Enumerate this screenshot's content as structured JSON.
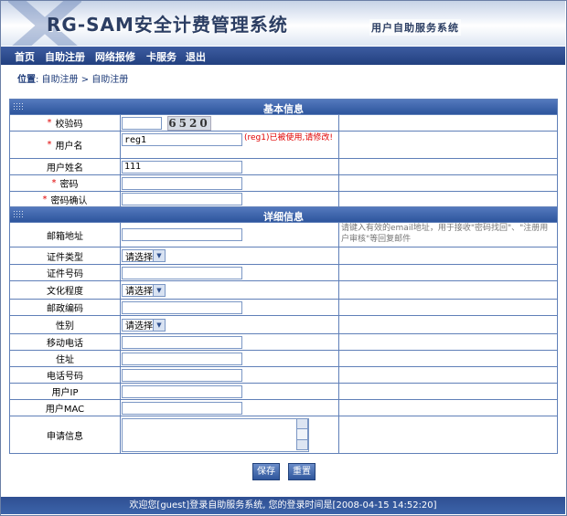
{
  "header": {
    "logo": "RG-SAM安全计费管理系统",
    "subtitle": "用户自助服务系统"
  },
  "nav": [
    "首页",
    "自助注册",
    "网络报修",
    "卡服务",
    "退出"
  ],
  "breadcrumb": {
    "label": "位置",
    "path": ": 自助注册 > 自助注册"
  },
  "basic": {
    "title": "基本信息",
    "captcha_label": "校验码",
    "captcha_code": "6520",
    "username_label": "用户名",
    "username_value": "reg1",
    "username_error": "(reg1)已被使用,请修改!",
    "realname_label": "用户姓名",
    "realname_value": "111",
    "password_label": "密码",
    "password_confirm_label": "密码确认"
  },
  "detail": {
    "title": "详细信息",
    "email_label": "邮箱地址",
    "email_hint": "请键入有效的email地址，用于接收\"密码找回\"、\"注册用户审核\"等回复邮件",
    "idtype_label": "证件类型",
    "idnum_label": "证件号码",
    "edu_label": "文化程度",
    "zip_label": "邮政编码",
    "gender_label": "性别",
    "mobile_label": "移动电话",
    "address_label": "住址",
    "phone_label": "电话号码",
    "ip_label": "用户IP",
    "mac_label": "用户MAC",
    "apply_label": "申请信息",
    "select_default": "请选择"
  },
  "buttons": {
    "save": "保存",
    "reset": "重置"
  },
  "footer": "欢迎您[guest]登录自助服务系统, 您的登录时间是[2008-04-15 14:52:20]",
  "colors": {
    "brand": "#2d559d",
    "error": "#e00000",
    "border": "#5f7fb8"
  }
}
